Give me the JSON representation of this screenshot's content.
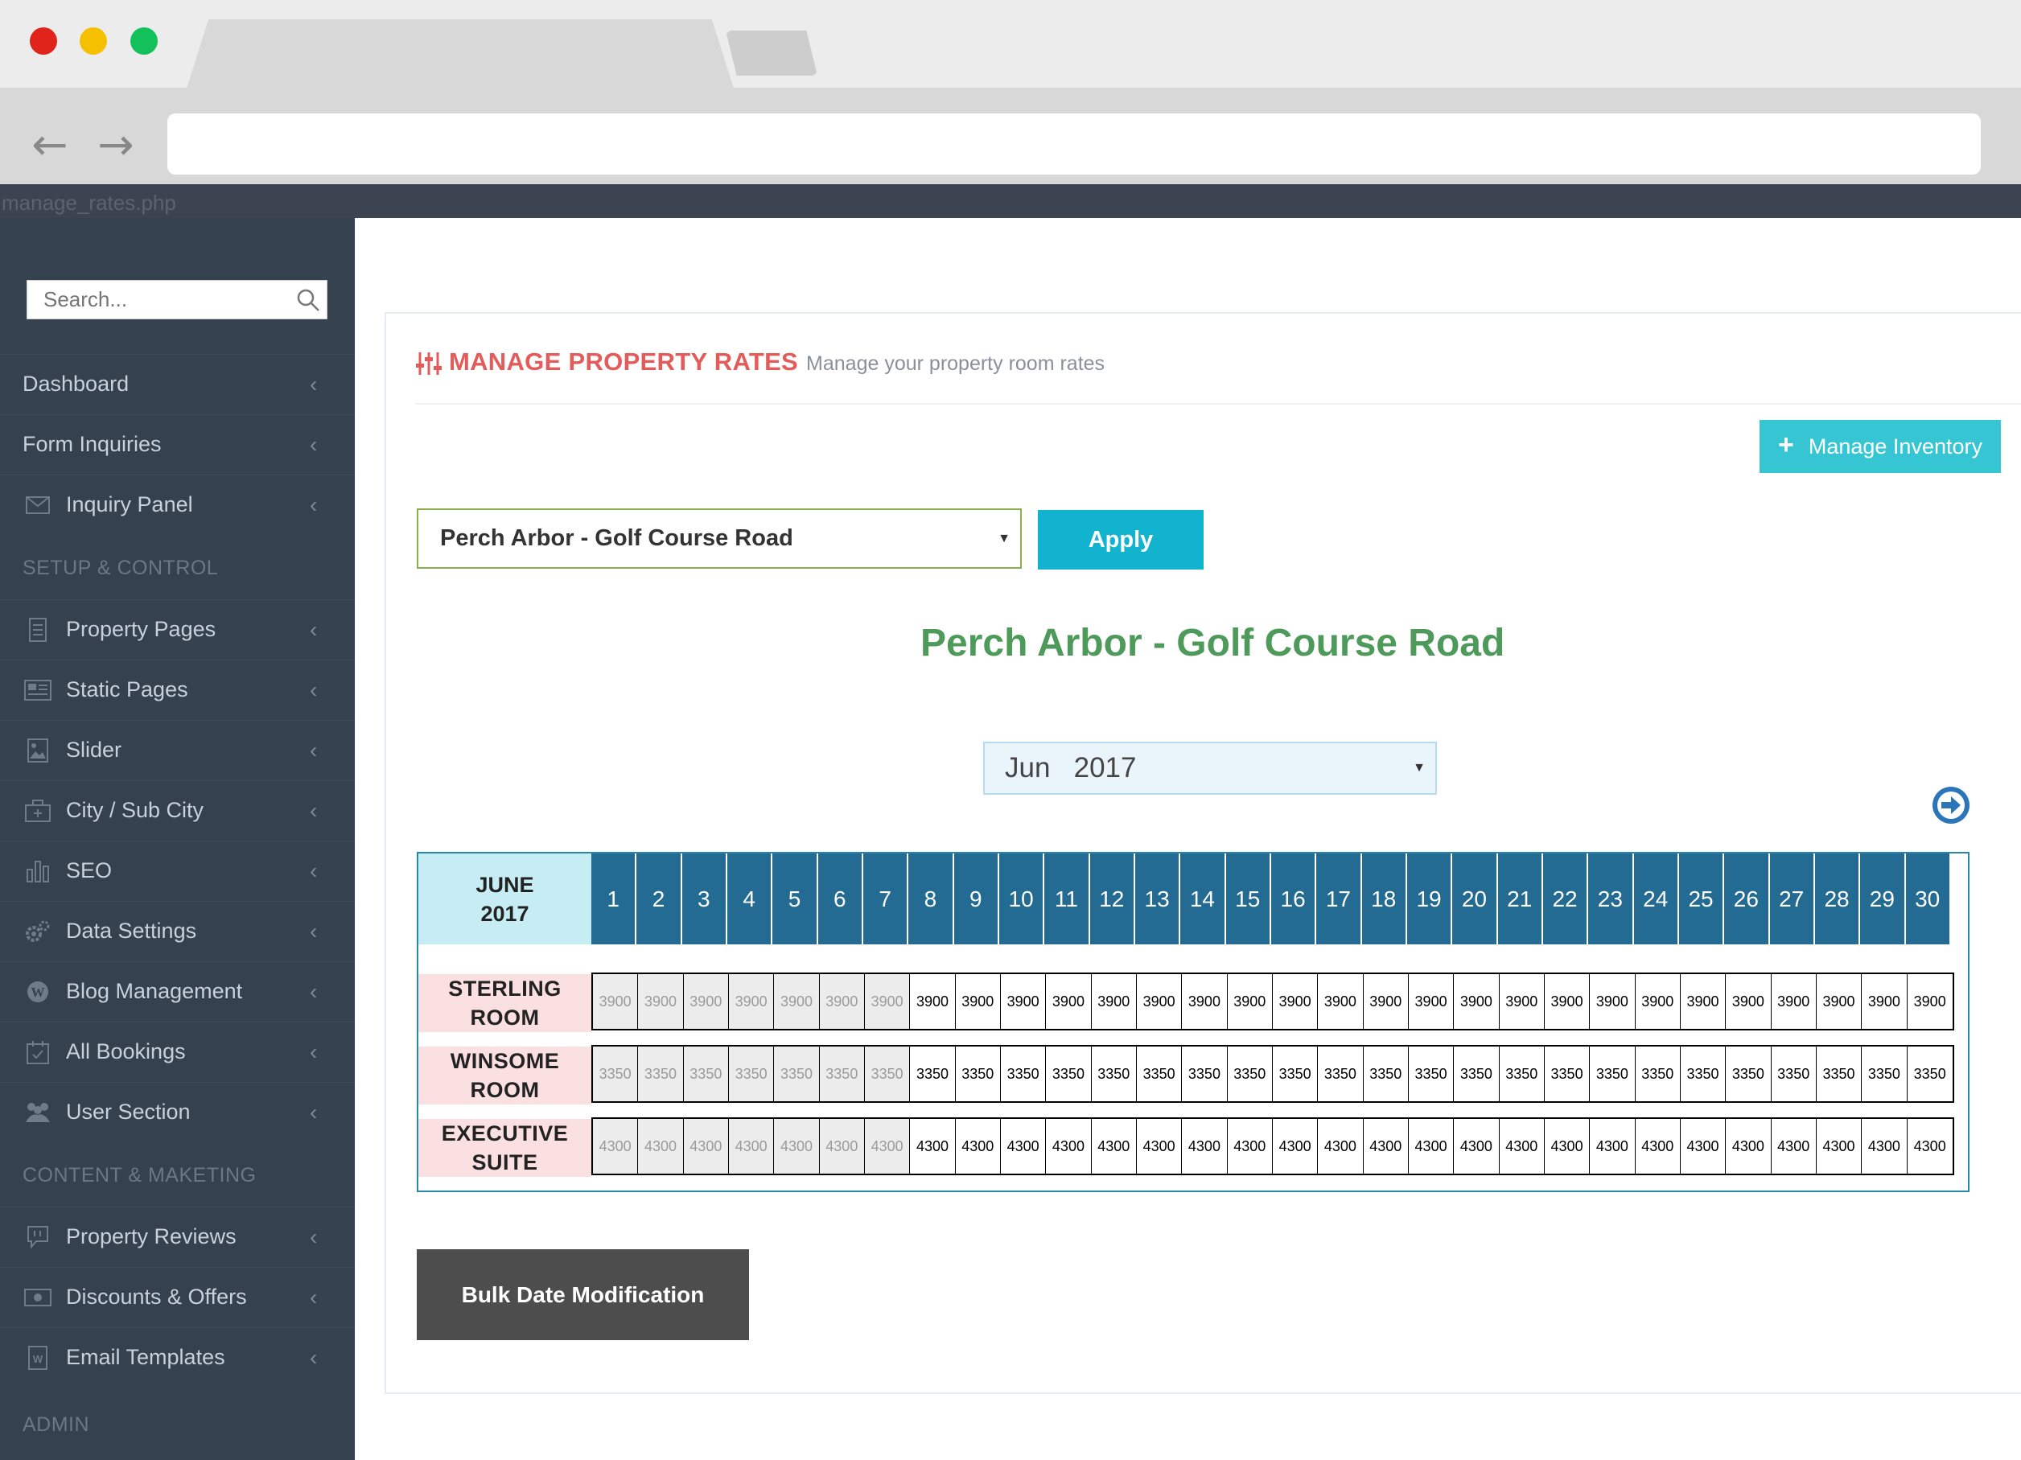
{
  "browser": {
    "address": ""
  },
  "app": {
    "url_caption": "manage_rates.php"
  },
  "sidebar": {
    "search_placeholder": "Search...",
    "items": [
      {
        "label": "Dashboard",
        "icon": "none"
      },
      {
        "label": "Form Inquiries",
        "icon": "none"
      },
      {
        "label": "Inquiry Panel",
        "icon": "envelope-icon"
      },
      {
        "label": "Property Pages",
        "icon": "document-icon"
      },
      {
        "label": "Static Pages",
        "icon": "newspaper-icon"
      },
      {
        "label": "Slider",
        "icon": "image-icon"
      },
      {
        "label": "City / Sub City",
        "icon": "briefcase-icon"
      },
      {
        "label": "SEO",
        "icon": "bar-chart-icon"
      },
      {
        "label": "Data Settings",
        "icon": "cogs-icon"
      },
      {
        "label": "Blog Management",
        "icon": "wordpress-icon"
      },
      {
        "label": "All Bookings",
        "icon": "calendar-check-icon"
      },
      {
        "label": "User Section",
        "icon": "users-icon"
      },
      {
        "label": "Property Reviews",
        "icon": "chat-icon"
      },
      {
        "label": "Discounts & Offers",
        "icon": "money-icon"
      },
      {
        "label": "Email Templates",
        "icon": "word-file-icon"
      }
    ],
    "headings": [
      "SETUP & CONTROL",
      "CONTENT & MAKETING",
      "ADMIN"
    ]
  },
  "page": {
    "title": "MANAGE PROPERTY RATES",
    "subtitle": "Manage your property room rates",
    "manage_inventory_label": "Manage Inventory",
    "property_select_value": "Perch Arbor - Golf Course Road",
    "apply_label": "Apply",
    "property_heading": "Perch Arbor - Golf Course Road",
    "month_select_value": "Jun   2017",
    "bulk_label": "Bulk Date Modification"
  },
  "rates_table": {
    "month_label_line1": "JUNE",
    "month_label_line2": "2017",
    "days": [
      "1",
      "2",
      "3",
      "4",
      "5",
      "6",
      "7",
      "8",
      "9",
      "10",
      "11",
      "12",
      "13",
      "14",
      "15",
      "16",
      "17",
      "18",
      "19",
      "20",
      "21",
      "22",
      "23",
      "24",
      "25",
      "26",
      "27",
      "28",
      "29",
      "30"
    ],
    "past_days_count": 7,
    "rooms": [
      {
        "line1": "STERLING",
        "line2": "ROOM",
        "rate": "3900"
      },
      {
        "line1": "WINSOME",
        "line2": "ROOM",
        "rate": "3350"
      },
      {
        "line1": "EXECUTIVE",
        "line2": "SUITE",
        "rate": "4300"
      }
    ]
  },
  "colors": {
    "sidebar_bg": "#364150",
    "title_red": "#e35b5a",
    "heading_green": "#4e9a5a",
    "day_header_blue": "#236b92",
    "apply_cyan": "#12b3cf",
    "inventory_cyan": "#36c6d3",
    "room_label_pink": "#fbe0e1"
  }
}
